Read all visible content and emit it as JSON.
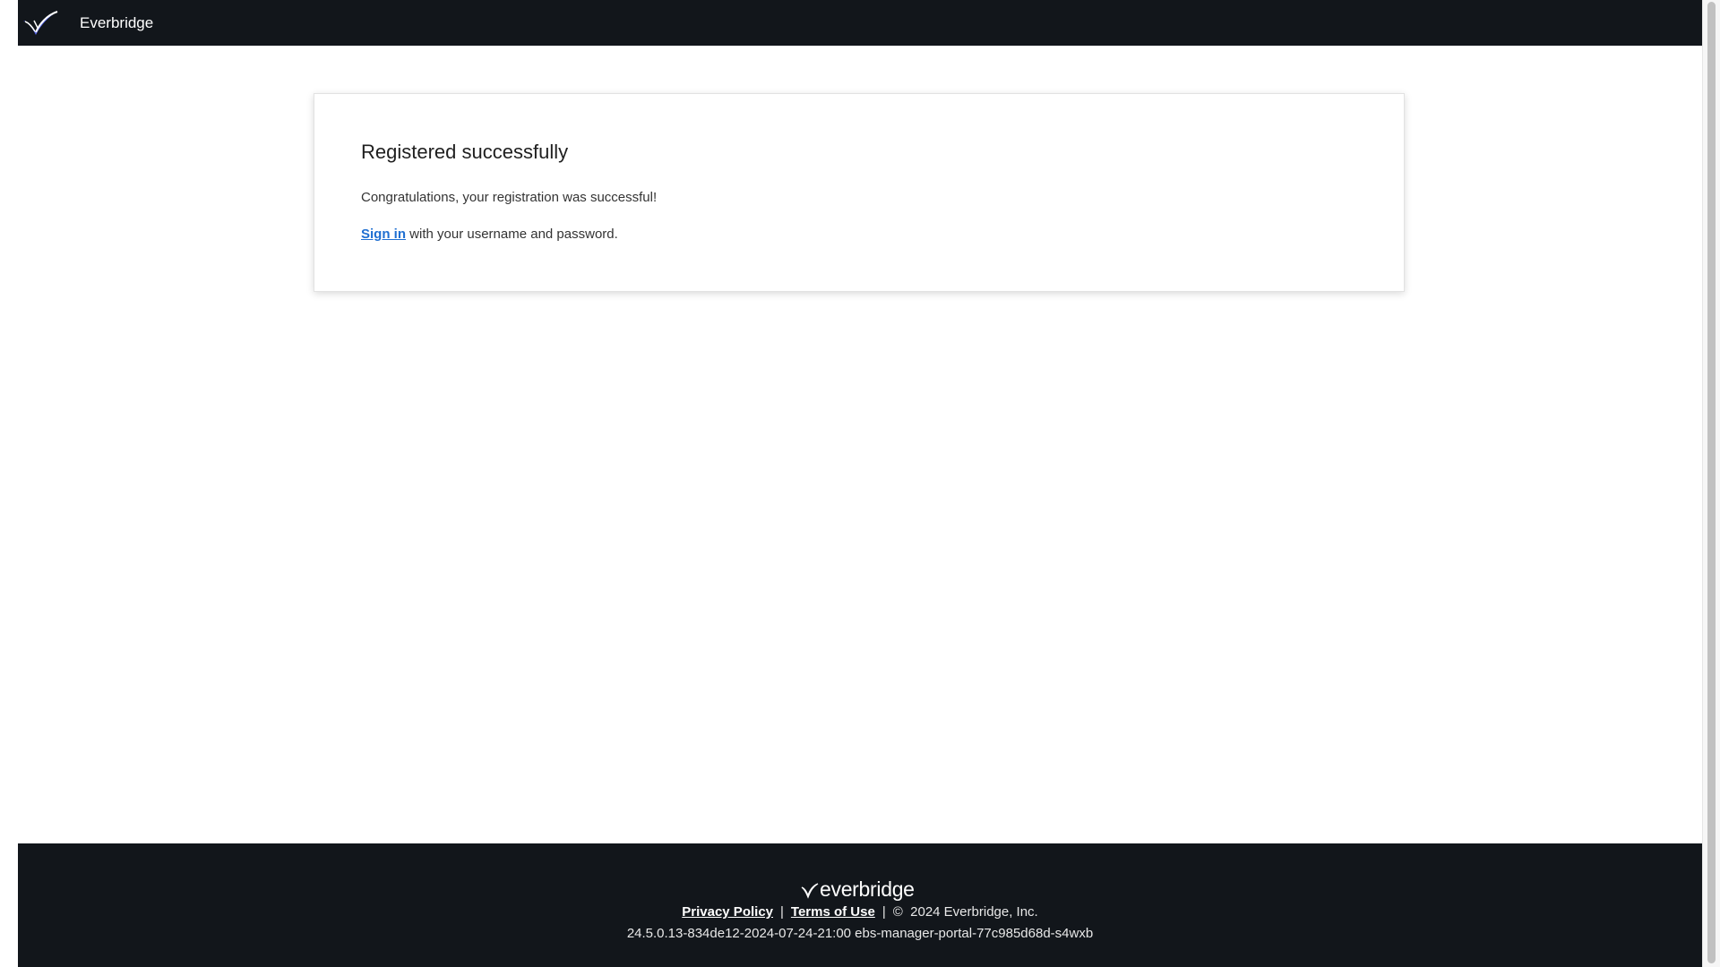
{
  "header": {
    "brand_name": "Everbridge",
    "logo_icon": "everbridge-bird-logo-icon"
  },
  "card": {
    "title": "Registered successfully",
    "message": "Congratulations, your registration was successful!",
    "signin_link": "Sign in",
    "signin_suffix": " with your username and password."
  },
  "footer": {
    "logo_text": "everbridge",
    "privacy_policy": "Privacy Policy",
    "separator": "|",
    "terms_of_use": "Terms of Use",
    "copyright_symbol": "©",
    "copyright_text": "2024 Everbridge, Inc.",
    "version": "24.5.0.13-834de12-2024-07-24-21:00 ebs-manager-portal-77c985d68d-s4wxb"
  },
  "colors": {
    "header_bg": "#12161b",
    "footer_bg": "#12161b",
    "link": "#1f6fd1",
    "logo_accent": "#5b6cf0"
  }
}
